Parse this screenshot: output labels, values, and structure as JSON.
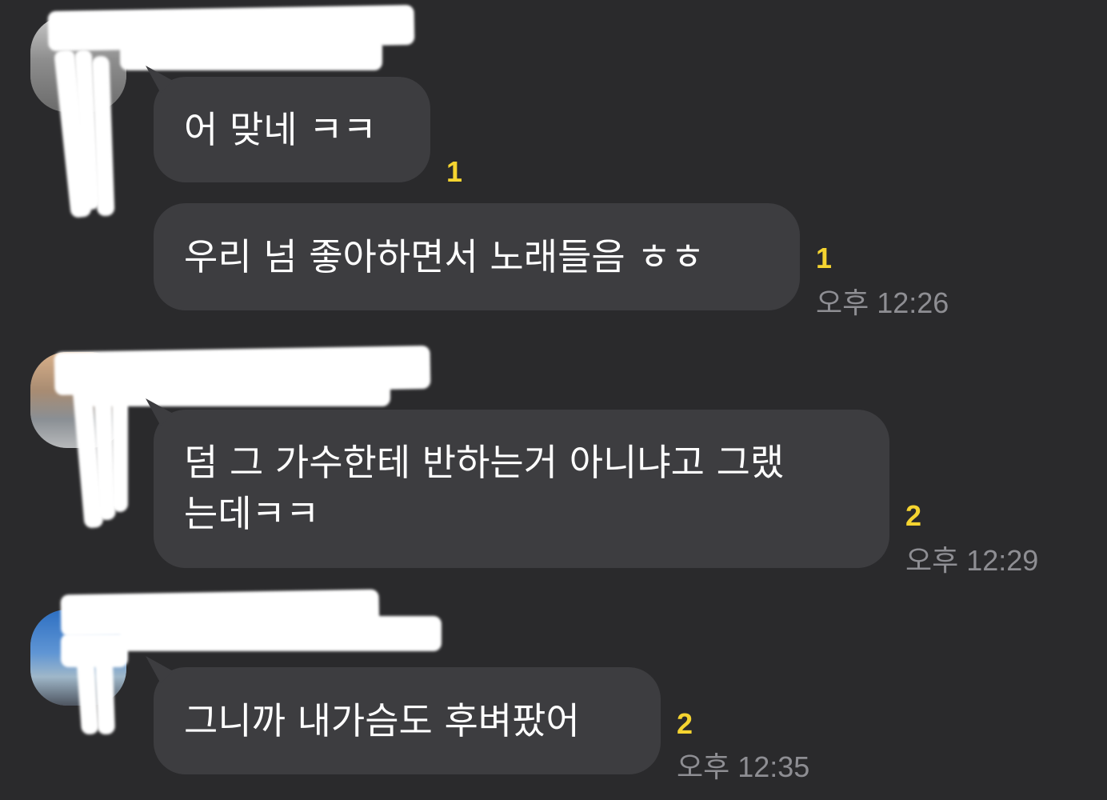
{
  "messages": [
    {
      "text": "어 맞네 ㅋㅋ",
      "unread": "1",
      "time": ""
    },
    {
      "text": "우리 넘 좋아하면서 노래들음 ㅎㅎ",
      "unread": "1",
      "time": "오후 12:26"
    },
    {
      "text_line1": "덤 그 가수한테 반하는거 아니냐고 그랬",
      "text_line2": "는데ㅋㅋ",
      "unread": "2",
      "time": "오후 12:29"
    },
    {
      "text": "그니까 내가슴도 후벼팠어",
      "unread": "2",
      "time": "오후 12:35"
    }
  ],
  "colors": {
    "background": "#2a2a2c",
    "bubble": "#3d3d40",
    "unread": "#f5d430",
    "time": "#8e8e93"
  }
}
